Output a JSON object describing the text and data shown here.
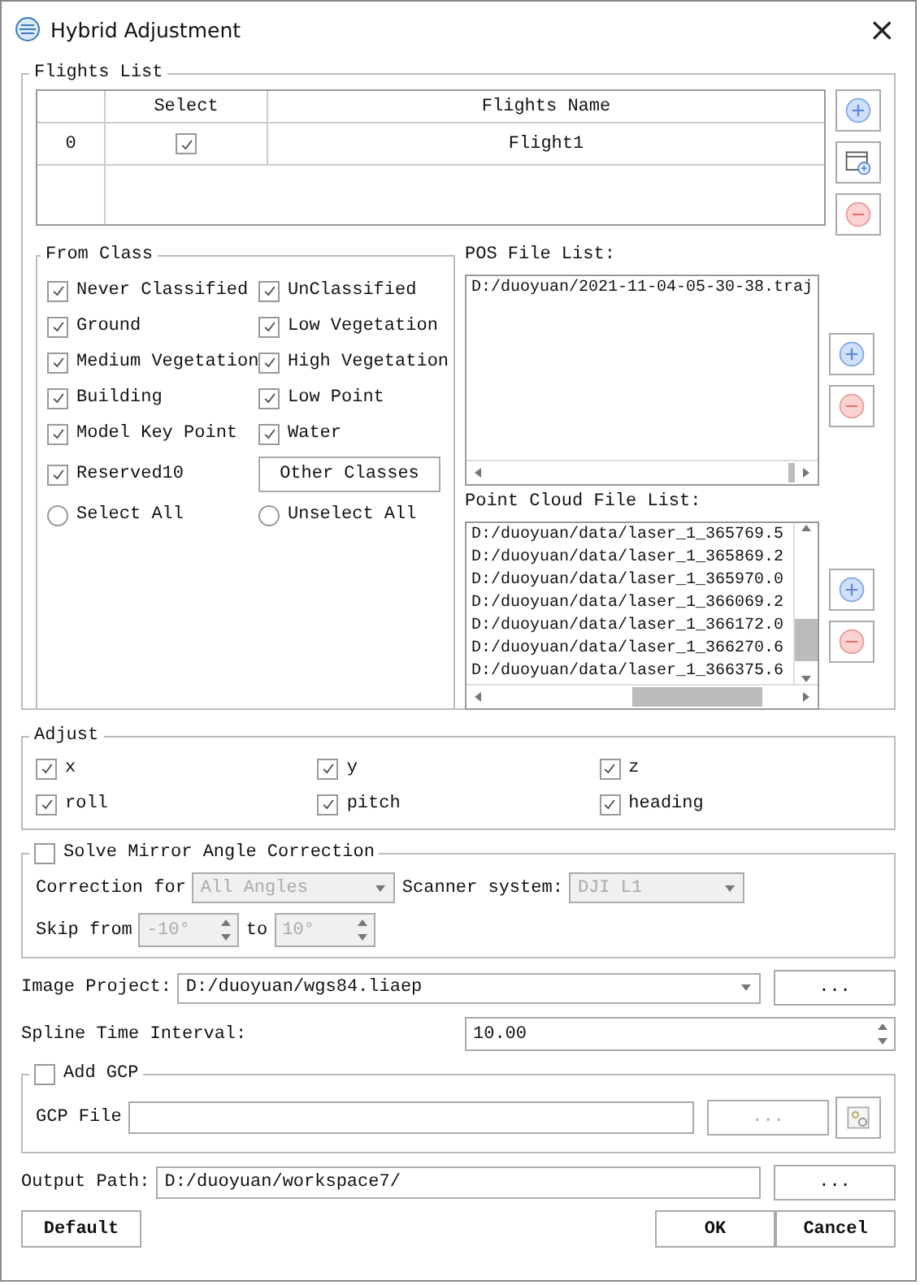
{
  "window": {
    "title": "Hybrid Adjustment",
    "close": "×"
  },
  "flights_list": {
    "title": "Flights List",
    "table": {
      "columns": [
        "Select",
        "Flights Name"
      ],
      "rows": [
        {
          "index": "0",
          "checked": true,
          "name": "Flight1"
        }
      ]
    }
  },
  "from_class": {
    "title": "From Class",
    "classes": [
      {
        "label": "Never Classified",
        "checked": true
      },
      {
        "label": "UnClassified",
        "checked": true
      },
      {
        "label": "Ground",
        "checked": true
      },
      {
        "label": "Low Vegetation",
        "checked": true
      },
      {
        "label": "Medium Vegetation",
        "checked": true
      },
      {
        "label": "High Vegetation",
        "checked": true
      },
      {
        "label": "Building",
        "checked": true
      },
      {
        "label": "Low Point",
        "checked": true
      },
      {
        "label": "Model Key Point",
        "checked": true
      },
      {
        "label": "Water",
        "checked": true
      },
      {
        "label": "Reserved10",
        "checked": true
      }
    ],
    "other_button": "Other Classes",
    "radios": [
      {
        "label": "Select All",
        "selected": false
      },
      {
        "label": "Unselect All",
        "selected": false
      }
    ]
  },
  "pos_file_list": {
    "label": "POS File List:",
    "files": [
      "D:/duoyuan/2021-11-04-05-30-38.traj"
    ]
  },
  "point_cloud_file_list": {
    "label": "Point Cloud File List:",
    "files": [
      "D:/duoyuan/data/laser_1_365769.5",
      "D:/duoyuan/data/laser_1_365869.2",
      "D:/duoyuan/data/laser_1_365970.0",
      "D:/duoyuan/data/laser_1_366069.2",
      "D:/duoyuan/data/laser_1_366172.0",
      "D:/duoyuan/data/laser_1_366270.6",
      "D:/duoyuan/data/laser_1_366375.6"
    ]
  },
  "adjust": {
    "title": "Adjust",
    "options": [
      {
        "label": "x",
        "checked": true
      },
      {
        "label": "y",
        "checked": true
      },
      {
        "label": "z",
        "checked": true
      },
      {
        "label": "roll",
        "checked": true
      },
      {
        "label": "pitch",
        "checked": true
      },
      {
        "label": "heading",
        "checked": true
      }
    ]
  },
  "mirror_correction": {
    "title": "Solve Mirror Angle Correction",
    "checked": false,
    "disabled": true,
    "correction_for_label": "Correction for",
    "correction_for_value": "All Angles",
    "scanner_label": "Scanner system:",
    "scanner_value": "DJI L1",
    "skip_from_label": "Skip from",
    "skip_from_value": "-10°",
    "to_label": "to",
    "to_value": "10°"
  },
  "image_project": {
    "label": "Image Project:",
    "value": "D:/duoyuan/wgs84.liaep",
    "browse": "..."
  },
  "spline_time_interval": {
    "label": "Spline Time Interval:",
    "value": "10.00"
  },
  "add_gcp": {
    "title": "Add GCP",
    "checked": false,
    "disabled": true,
    "gcp_file_label": "GCP File",
    "browse": "..."
  },
  "output_path": {
    "label": "Output Path:",
    "value": "D:/duoyuan/workspace7/",
    "browse": "..."
  },
  "buttons": {
    "default": "Default",
    "ok": "OK",
    "cancel": "Cancel"
  }
}
